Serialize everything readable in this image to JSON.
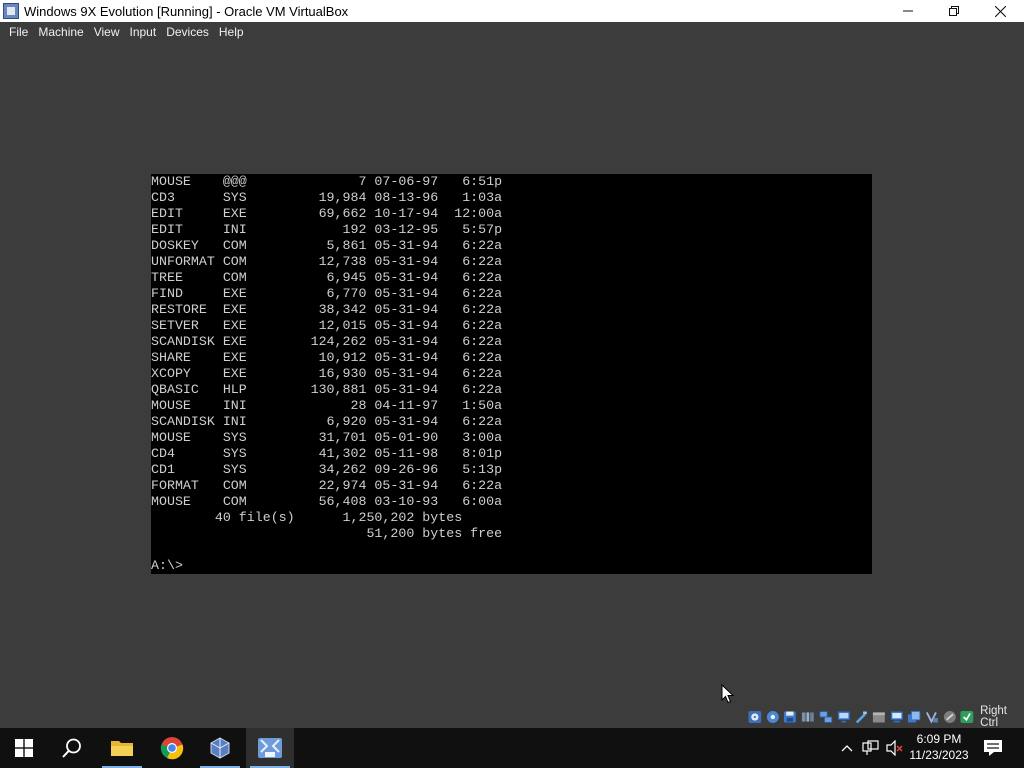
{
  "window": {
    "title": "Windows 9X Evolution [Running] - Oracle VM VirtualBox",
    "controls": {
      "minimize": "minimize",
      "maximize": "restore",
      "close": "close"
    }
  },
  "menu": [
    "File",
    "Machine",
    "View",
    "Input",
    "Devices",
    "Help"
  ],
  "console": {
    "lines": [
      "MOUSE    @@@              7 07-06-97   6:51p",
      "CD3      SYS         19,984 08-13-96   1:03a",
      "EDIT     EXE         69,662 10-17-94  12:00a",
      "EDIT     INI            192 03-12-95   5:57p",
      "DOSKEY   COM          5,861 05-31-94   6:22a",
      "UNFORMAT COM         12,738 05-31-94   6:22a",
      "TREE     COM          6,945 05-31-94   6:22a",
      "FIND     EXE          6,770 05-31-94   6:22a",
      "RESTORE  EXE         38,342 05-31-94   6:22a",
      "SETVER   EXE         12,015 05-31-94   6:22a",
      "SCANDISK EXE        124,262 05-31-94   6:22a",
      "SHARE    EXE         10,912 05-31-94   6:22a",
      "XCOPY    EXE         16,930 05-31-94   6:22a",
      "QBASIC   HLP        130,881 05-31-94   6:22a",
      "MOUSE    INI             28 04-11-97   1:50a",
      "SCANDISK INI          6,920 05-31-94   6:22a",
      "MOUSE    SYS         31,701 05-01-90   3:00a",
      "CD4      SYS         41,302 05-11-98   8:01p",
      "CD1      SYS         34,262 09-26-96   5:13p",
      "FORMAT   COM         22,974 05-31-94   6:22a",
      "MOUSE    COM         56,408 03-10-93   6:00a",
      "        40 file(s)      1,250,202 bytes",
      "                           51,200 bytes free",
      "",
      "A:\\>"
    ]
  },
  "statusbar": {
    "icons": [
      "optical-drive-icon",
      "floppy-icon",
      "hard-disk-icon",
      "audio-icon",
      "network-icon",
      "usb-icon",
      "shared-folders-icon",
      "display-icon",
      "recording-icon",
      "mouse-integration-icon",
      "cpu-icon",
      "arrow-icon"
    ],
    "host_key": "Right Ctrl"
  },
  "taskbar": {
    "apps": [
      "start-icon",
      "search-icon",
      "file-explorer-icon",
      "chrome-icon",
      "virtualbox-icon",
      "windows-me-vm-icon"
    ],
    "time": "6:09 PM",
    "date": "11/23/2023"
  },
  "colors": {
    "host_background": "#3c3c3c",
    "console_background": "#000000",
    "console_text": "#cfcfcf",
    "taskbar": "#101010"
  }
}
